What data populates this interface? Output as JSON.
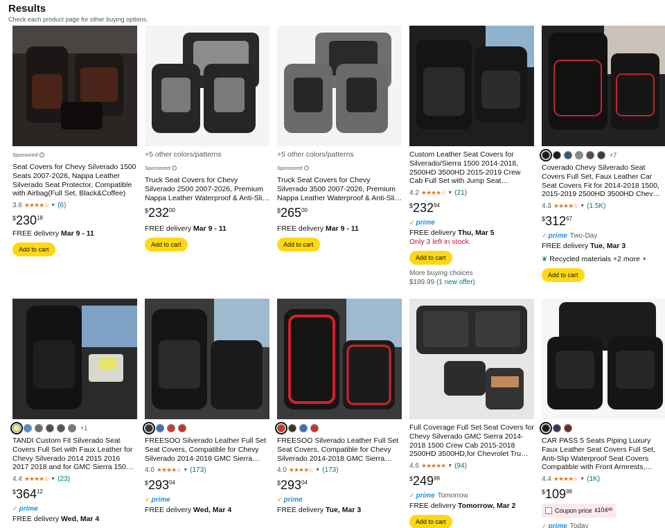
{
  "header": {
    "title": "Results",
    "subtitle": "Check each product page for other buying options."
  },
  "colors": {
    "accent_button": "#ffd814",
    "star": "#de7921",
    "link": "#007185",
    "prime": "#1e8fe1",
    "stock_red": "#cc0c39"
  },
  "products": [
    {
      "sponsored": "Sponsored",
      "title": "Seat Covers for Chevy Silverado 1500 Seats 2007-2026, Nappa Leather Silverado Seat Protector, Compatible with Airbag(Full Set, Black&Coffee)",
      "rating": "3.6",
      "stars": "★★★★☆",
      "count": "(6)",
      "price_whole": "230",
      "price_frac": "18",
      "delivery_prefix": "FREE delivery",
      "delivery_date": "Mar 9 - 11",
      "cart": "Add to cart"
    },
    {
      "colors_link": "+5 other colors/patterns",
      "sponsored": "Sponsored",
      "title": "Truck Seat Covers for Chevy Silverado 2500 2007-2026, Premium Nappa Leather Waterproof & Anti-Slip, Full Coverage Customized fit…",
      "price_whole": "232",
      "price_frac": "00",
      "delivery_prefix": "FREE delivery",
      "delivery_date": "Mar 9 - 11",
      "cart": "Add to cart"
    },
    {
      "colors_link": "+5 other colors/patterns",
      "sponsored": "Sponsored",
      "title": "Truck Seat Covers for Chevy Silverado 3500 2007-2026, Premium Nappa Leather Waterproof & Anti-Slip, Full Coverage Customized fit…",
      "price_whole": "265",
      "price_frac": "00",
      "delivery_prefix": "FREE delivery",
      "delivery_date": "Mar 9 - 11",
      "cart": "Add to cart"
    },
    {
      "title": "Custom Leather Seat Covers for Silverado/Sierra 1500 2014-2018, 2500HD 3500HD 2015-2019 Crew Cab Full Set with Jump Seat…",
      "rating": "4.2",
      "stars": "★★★★☆",
      "count": "(21)",
      "price_whole": "232",
      "price_frac": "94",
      "prime": "prime",
      "delivery_prefix": "FREE delivery",
      "delivery_date": "Thu, Mar 5",
      "stock": "Only 3 left in stock.",
      "cart": "Add to cart",
      "more_buying": "More buying choices",
      "more_price": "$189.99",
      "more_offer": "(1 new offer)"
    },
    {
      "swatch_more": "+7",
      "title": "Coverado Chevy Silverado Seat Covers Full Set, Faux Leather Car Seat Covers Fit for 2014-2018 1500, 2015-2019 2500HD 3500HD Chev…",
      "rating": "4.3",
      "stars": "★★★★☆",
      "count": "(1.5K)",
      "price_whole": "312",
      "price_frac": "67",
      "prime": "prime",
      "prime_tag": "Two-Day",
      "delivery_prefix": "FREE delivery",
      "delivery_date": "Tue, Mar 3",
      "recycled": "Recycled materials +2 more",
      "cart": "Add to cart"
    },
    {
      "swatch_more": "+1",
      "title": "TANDI Custom Fit Silverado Seat Covers Full Set with Faux Leather for Chevy Silverado 2014 2015 2016 2017 2018 and for GMC Sierra 150…",
      "rating": "4.4",
      "stars": "★★★★☆",
      "count": "(23)",
      "price_whole": "364",
      "price_frac": "12",
      "prime": "prime",
      "delivery_prefix": "FREE delivery",
      "delivery_date": "Wed, Mar 4"
    },
    {
      "title": "FREESOO Silverado Leather Full Set Seat Covers, Compatible for Chevy Silverado 2014-2018 GMC Sierra 1500 2500 3500 Crew Cab…",
      "rating": "4.0",
      "stars": "★★★★☆",
      "count": "(173)",
      "price_whole": "293",
      "price_frac": "04",
      "prime": "prime",
      "delivery_prefix": "FREE delivery",
      "delivery_date": "Wed, Mar 4"
    },
    {
      "title": "FREESOO Silverado Leather Full Set Seat Covers, Compatible for Chevy Silverado 2014-2018 GMC Sierra 1500 2500 3500 Crew Cab…",
      "rating": "4.0",
      "stars": "★★★★☆",
      "count": "(173)",
      "price_whole": "293",
      "price_frac": "04",
      "prime": "prime",
      "delivery_prefix": "FREE delivery",
      "delivery_date": "Tue, Mar 3"
    },
    {
      "title": "Full Coverage Full Set Seat Covers for Chevy Silverado GMC Sierra 2014-2018 1500 Crew Cab 2015-2018 2500HD 3500HD,for Chevrolet Tru…",
      "rating": "4.6",
      "stars": "★★★★★",
      "count": "(94)",
      "price_whole": "249",
      "price_frac": "99",
      "prime": "prime",
      "prime_tag": "Tomorrow",
      "delivery_prefix": "FREE delivery",
      "delivery_date": "Tomorrow, Mar 2",
      "cart": "Add to cart"
    },
    {
      "title": "CAR PASS 5 Seats Piping Luxury Faux Leather Seat Covers Full Set, Anti-Slip Waterproof Seat Covers Compatible with Front Armrests,…",
      "rating": "4.4",
      "stars": "★★★★☆",
      "count": "(1K)",
      "price_whole": "109",
      "price_frac": "98",
      "coupon_label": "Coupon price",
      "coupon_whole": "104",
      "coupon_frac": "48",
      "prime": "prime",
      "prime_tag": "Today"
    }
  ]
}
